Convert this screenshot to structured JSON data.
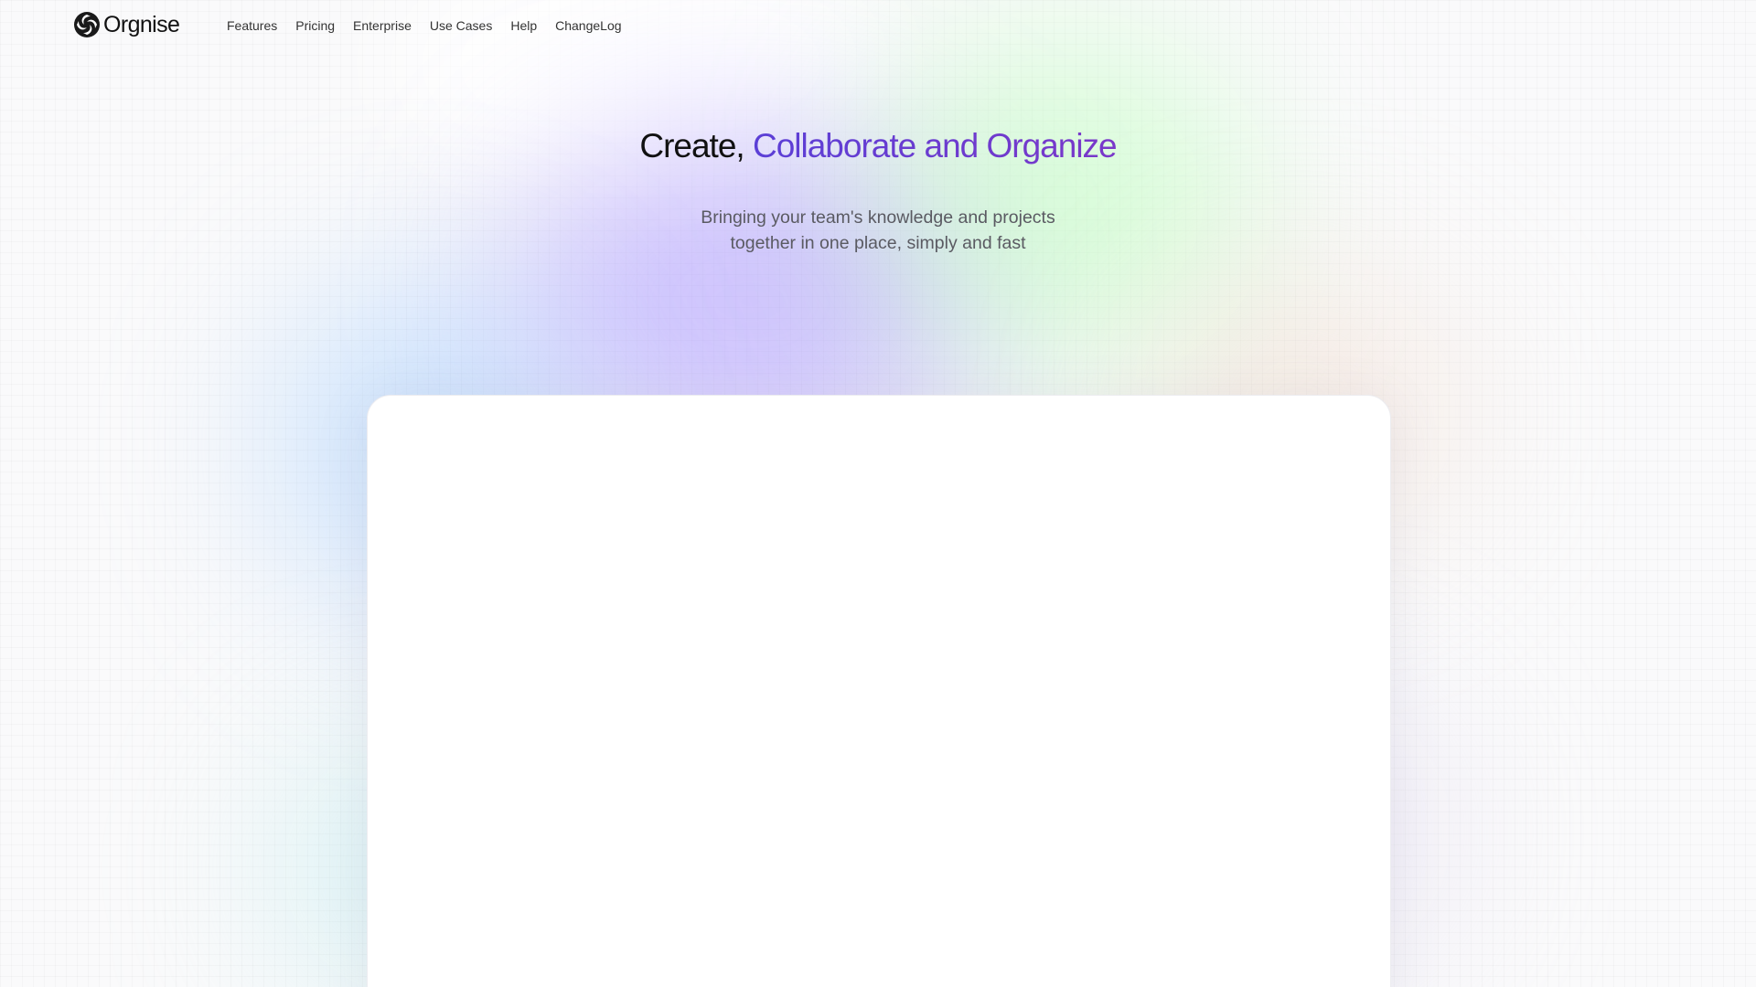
{
  "brand": {
    "name": "Orgnise",
    "logo_icon": "aperture-swirl-icon"
  },
  "nav": {
    "links": [
      {
        "label": "Features"
      },
      {
        "label": "Pricing"
      },
      {
        "label": "Enterprise"
      },
      {
        "label": "Use Cases"
      },
      {
        "label": "Help"
      },
      {
        "label": "ChangeLog"
      }
    ]
  },
  "hero": {
    "headline_plain": "Create,",
    "headline_accent": "Collaborate and Organize",
    "subtitle_line1": "Bringing your team's knowledge and projects",
    "subtitle_line2": "together in one place, simply and fast"
  },
  "colors": {
    "accent": "#5d3bd3",
    "text": "#111111",
    "muted": "#5a5a62"
  }
}
